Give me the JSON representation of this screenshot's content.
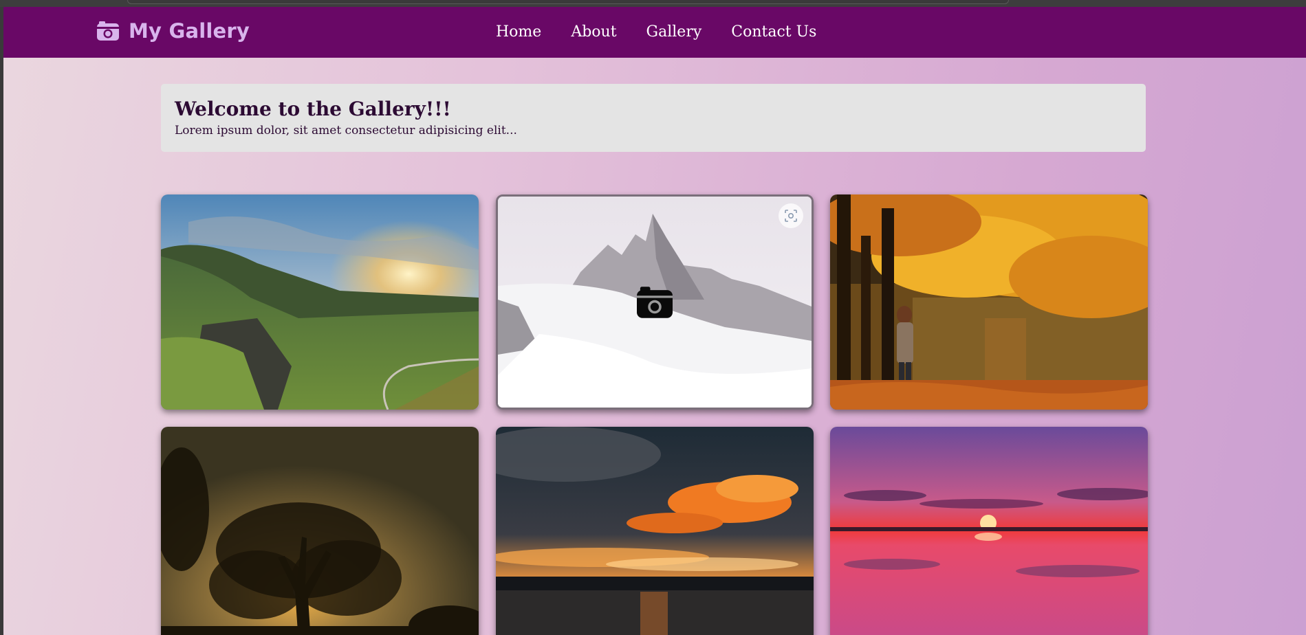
{
  "brand": {
    "name": "My Gallery",
    "icon": "camera-retro-icon",
    "color": "#d8b4ec"
  },
  "nav": {
    "home": "Home",
    "about": "About",
    "gallery": "Gallery",
    "contact": "Contact Us"
  },
  "welcome": {
    "title": "Welcome to the Gallery!!!",
    "text": "Lorem ipsum dolor, sit amet consectetur adipisicing elit..."
  },
  "gallery": {
    "photos": [
      {
        "subject": "green valley with sunrise"
      },
      {
        "subject": "snowy mountain peak",
        "hover_icon": "camera-icon",
        "action_icon": "scan-icon"
      },
      {
        "subject": "autumn trees by lake with person"
      },
      {
        "subject": "tree silhouette at sunset"
      },
      {
        "subject": "orange clouds over lake"
      },
      {
        "subject": "pink sunset reflection on water"
      }
    ]
  },
  "colors": {
    "navbar": "#690866",
    "accent": "#d8b4ec",
    "heading": "#2c0a33"
  }
}
